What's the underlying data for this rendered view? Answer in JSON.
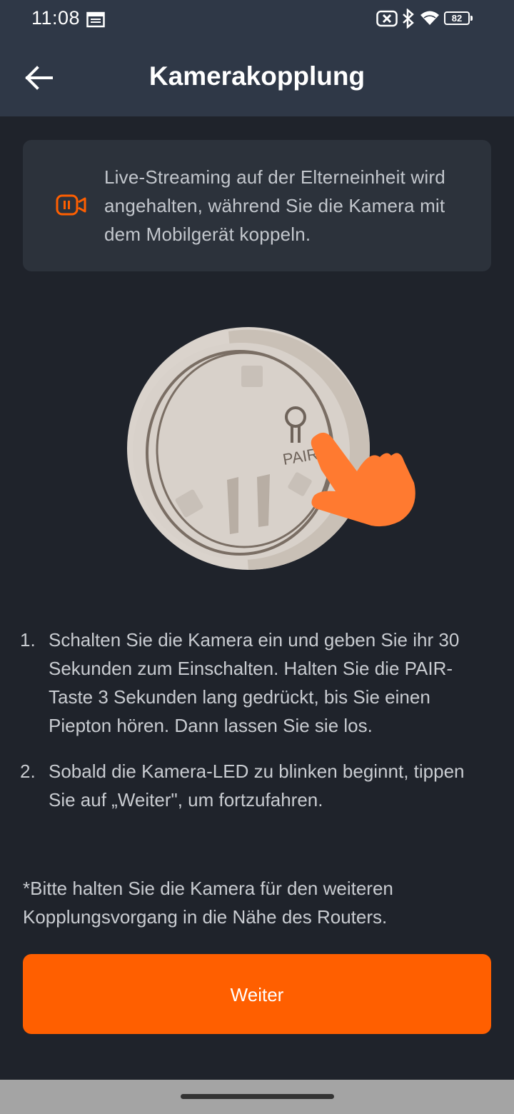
{
  "status_bar": {
    "time": "11:08",
    "battery": "82",
    "icons": [
      "calendar-icon",
      "sim-off-icon",
      "bluetooth-icon",
      "wifi-icon",
      "battery-icon"
    ]
  },
  "header": {
    "title": "Kamerakopplung",
    "back_icon": "arrow-left-icon"
  },
  "notice": {
    "icon": "camera-paused-icon",
    "text": "Live-Streaming auf der Elterneinheit wird angehalten, während Sie die Kamera mit dem Mobilgerät koppeln."
  },
  "illustration": {
    "label": "PAIR"
  },
  "steps": [
    {
      "number": "1.",
      "text": "Schalten Sie die Kamera ein und geben Sie ihr 30 Sekunden zum Einschalten. Halten Sie die PAIR-Taste 3 Sekunden lang gedrückt, bis Sie einen Piepton hören. Dann lassen Sie sie los."
    },
    {
      "number": "2.",
      "text": "Sobald die Kamera-LED zu blinken beginnt, tippen Sie auf „Weiter\", um fortzufahren."
    }
  ],
  "footnote": "*Bitte halten Sie die Kamera für den weiteren Kopplungsvorgang in die Nähe des Routers.",
  "button": {
    "label": "Weiter"
  },
  "colors": {
    "accent": "#ff5f00",
    "background": "#1f232b",
    "header": "#2f3847",
    "card": "#2c323b"
  }
}
